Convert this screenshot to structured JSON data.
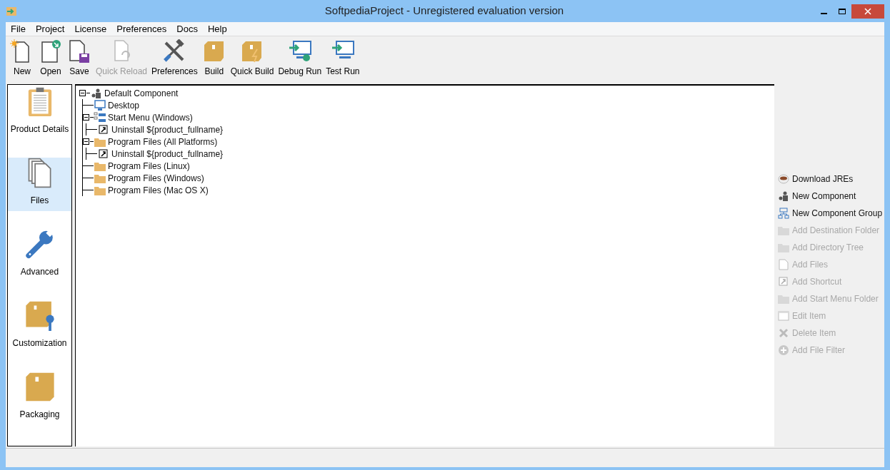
{
  "window": {
    "title": "SoftpediaProject - Unregistered evaluation version"
  },
  "menu": [
    "File",
    "Project",
    "License",
    "Preferences",
    "Docs",
    "Help"
  ],
  "toolbar": [
    {
      "label": "New",
      "kind": "new",
      "disabled": false
    },
    {
      "label": "Open",
      "kind": "open",
      "disabled": false
    },
    {
      "label": "Save",
      "kind": "save",
      "disabled": false
    },
    {
      "label": "Quick Reload",
      "kind": "reload",
      "disabled": true
    },
    {
      "label": "Preferences",
      "kind": "tools",
      "disabled": false
    },
    {
      "label": "Build",
      "kind": "box",
      "disabled": false
    },
    {
      "label": "Quick Build",
      "kind": "quickbox",
      "disabled": false
    },
    {
      "label": "Debug Run",
      "kind": "debug",
      "disabled": false
    },
    {
      "label": "Test Run",
      "kind": "run",
      "disabled": false
    }
  ],
  "sidebar": [
    {
      "label": "Product Details",
      "kind": "clipboard",
      "selected": false
    },
    {
      "label": "Files",
      "kind": "files",
      "selected": true
    },
    {
      "label": "Advanced",
      "kind": "wrench",
      "selected": false
    },
    {
      "label": "Customization",
      "kind": "boxwrench",
      "selected": false
    },
    {
      "label": "Packaging",
      "kind": "box",
      "selected": false
    }
  ],
  "tree": [
    {
      "label": "Default Component",
      "kind": "component",
      "expanded": true,
      "children": [
        {
          "label": "Desktop",
          "kind": "desktop"
        },
        {
          "label": "Start Menu (Windows)",
          "kind": "startmenu",
          "expanded": true,
          "children": [
            {
              "label": "Uninstall ${product_fullname}",
              "kind": "shortcut"
            }
          ]
        },
        {
          "label": "Program Files (All Platforms)",
          "kind": "folder",
          "expanded": true,
          "children": [
            {
              "label": "Uninstall ${product_fullname}",
              "kind": "shortcut"
            }
          ]
        },
        {
          "label": "Program Files (Linux)",
          "kind": "folder"
        },
        {
          "label": "Program Files (Windows)",
          "kind": "folder"
        },
        {
          "label": "Program Files (Mac OS X)",
          "kind": "folder"
        }
      ]
    }
  ],
  "actions": [
    {
      "label": "Download JREs",
      "kind": "cup",
      "disabled": false
    },
    {
      "label": "New Component",
      "kind": "component",
      "disabled": false
    },
    {
      "label": "New Component Group",
      "kind": "group",
      "disabled": false
    },
    {
      "label": "Add Destination Folder",
      "kind": "folder",
      "disabled": true
    },
    {
      "label": "Add Directory Tree",
      "kind": "folder",
      "disabled": true
    },
    {
      "label": "Add Files",
      "kind": "file",
      "disabled": true
    },
    {
      "label": "Add Shortcut",
      "kind": "shortcut",
      "disabled": true
    },
    {
      "label": "Add Start Menu Folder",
      "kind": "folder",
      "disabled": true
    },
    {
      "label": "Edit Item",
      "kind": "edit",
      "disabled": true
    },
    {
      "label": "Delete Item",
      "kind": "delete",
      "disabled": true
    },
    {
      "label": "Add File Filter",
      "kind": "add",
      "disabled": true
    }
  ]
}
